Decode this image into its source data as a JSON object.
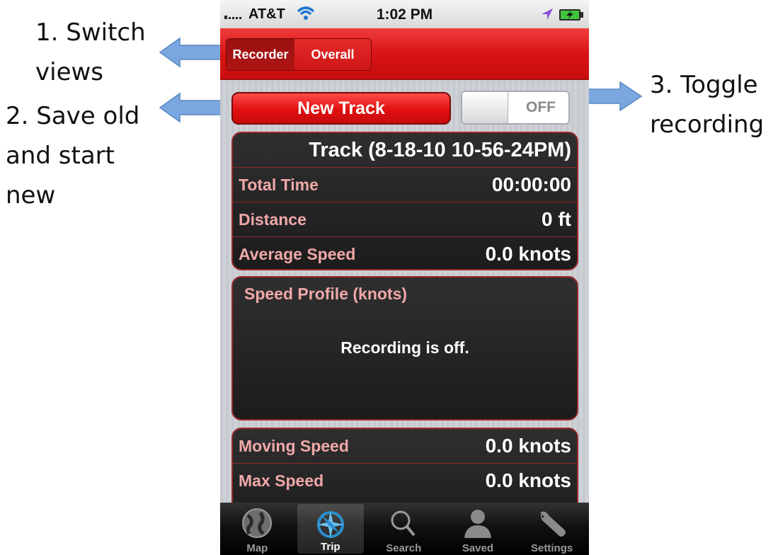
{
  "annotations": [
    {
      "text": "1. Switch\nviews"
    },
    {
      "text": "2. Save old\nand start\nnew"
    },
    {
      "text": "3. Toggle\nrecording"
    }
  ],
  "status_bar": {
    "carrier": "AT&T",
    "time": "1:02 PM"
  },
  "nav": {
    "segments": {
      "recorder": "Recorder",
      "overall": "Overall"
    },
    "selected": "Recorder"
  },
  "controls": {
    "new_track": "New Track",
    "recording_state": "OFF"
  },
  "track": {
    "title": "Track (8-18-10 10-56-24PM)",
    "rows": [
      {
        "label": "Total Time",
        "value": "00:00:00"
      },
      {
        "label": "Distance",
        "value": "0 ft"
      },
      {
        "label": "Average Speed",
        "value": "0.0 knots"
      }
    ]
  },
  "speed_profile": {
    "title": "Speed Profile (knots)",
    "message": "Recording is off."
  },
  "speeds": [
    {
      "label": "Moving Speed",
      "value": "0.0 knots"
    },
    {
      "label": "Max Speed",
      "value": "0.0 knots"
    }
  ],
  "tabs": [
    {
      "label": "Map",
      "icon": "globe-icon"
    },
    {
      "label": "Trip",
      "icon": "compass-icon"
    },
    {
      "label": "Search",
      "icon": "magnifier-icon"
    },
    {
      "label": "Saved",
      "icon": "person-icon"
    },
    {
      "label": "Settings",
      "icon": "wrench-icon"
    }
  ],
  "active_tab": "Trip",
  "colors": {
    "accent_red": "#d91414",
    "arrow_blue": "#7aa7e0",
    "panel_dark": "#252526",
    "label_pink": "#f0a8a8"
  }
}
